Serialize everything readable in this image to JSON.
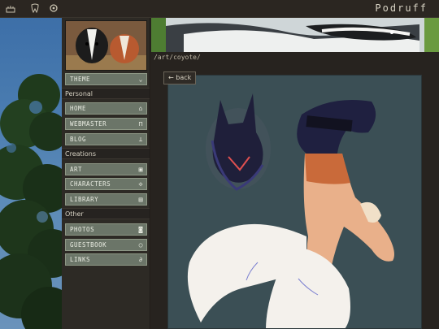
{
  "site": {
    "title": "Podruff"
  },
  "topbar": {
    "icons": [
      "cake-icon",
      "tooth-icon",
      "settings-icon"
    ]
  },
  "sidebar": {
    "theme_label": "THEME",
    "sections": [
      {
        "label": "Personal",
        "items": [
          {
            "label": "HOME",
            "icon": "home-icon"
          },
          {
            "label": "WEBMASTER",
            "icon": "lock-icon"
          },
          {
            "label": "BLOG",
            "icon": "signpost-icon"
          }
        ]
      },
      {
        "label": "Creations",
        "items": [
          {
            "label": "ART",
            "icon": "image-icon"
          },
          {
            "label": "CHARACTERS",
            "icon": "paw-icon"
          },
          {
            "label": "LIBRARY",
            "icon": "book-icon"
          }
        ]
      },
      {
        "label": "Other",
        "items": [
          {
            "label": "PHOTOS",
            "icon": "camera-icon"
          },
          {
            "label": "GUESTBOOK",
            "icon": "chat-icon"
          },
          {
            "label": "LINKS",
            "icon": "paperclip-icon"
          }
        ]
      }
    ]
  },
  "main": {
    "path": "/art/coyote/",
    "back_label": "back"
  }
}
